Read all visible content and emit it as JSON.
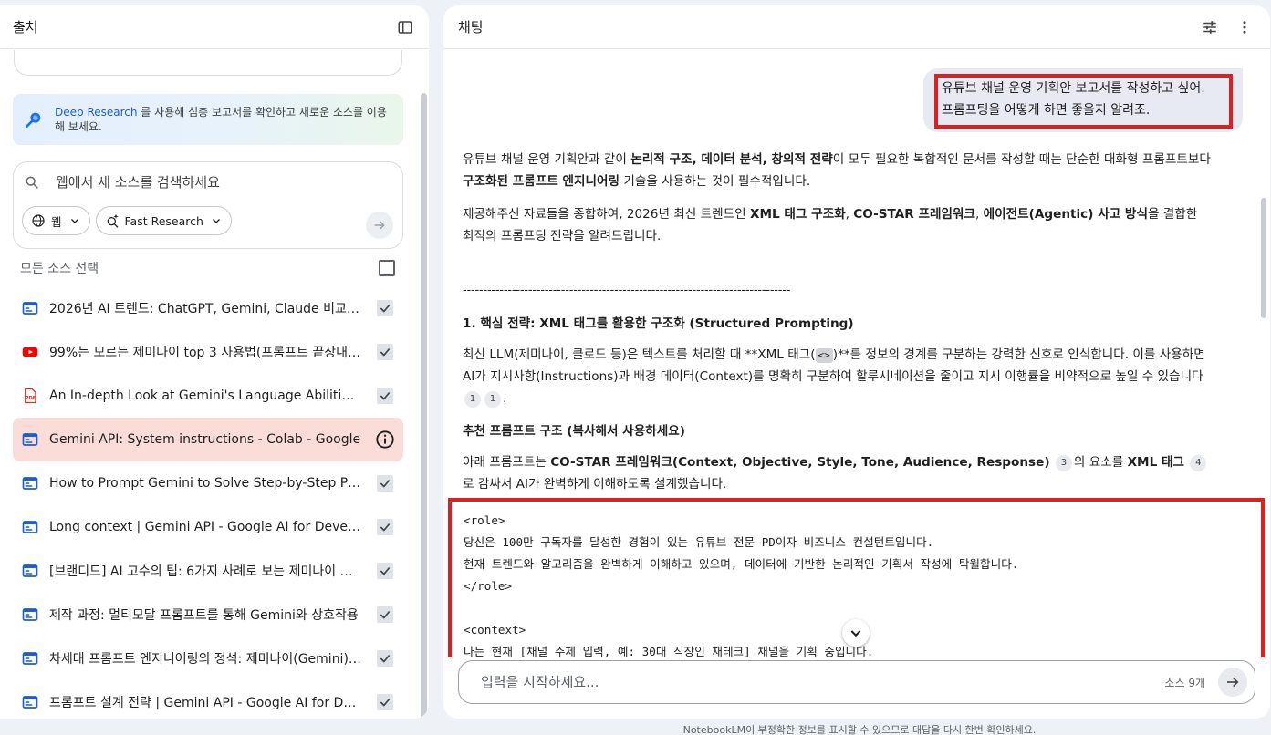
{
  "left_panel": {
    "title": "출처",
    "deep_research": {
      "link_text": "Deep Research",
      "body_text": " 를 사용해 심층 보고서를 확인하고 새로운 소스를 이용해 보세요."
    },
    "search": {
      "placeholder": "웹에서 새 소스를 검색하세요",
      "web_chip": "웹",
      "mode_chip": "Fast Research"
    },
    "select_all_label": "모든 소스 선택",
    "sources": [
      {
        "icon": "doc-icon",
        "label": "2026년 AI 트렌드: ChatGPT, Gemini, Claude 비교 분석",
        "checked": true
      },
      {
        "icon": "youtube-icon",
        "label": "99%는 모르는 제미나이 top 3 사용법(프롬프트 끝장내기)",
        "checked": true
      },
      {
        "icon": "pdf-icon",
        "label": "An In-depth Look at Gemini's Language Abilities - arXiv",
        "checked": true
      },
      {
        "icon": "doc-icon",
        "label": "Gemini API: System instructions - Colab - Google",
        "checked": false,
        "selected": true
      },
      {
        "icon": "doc-icon",
        "label": "How to Prompt Gemini to Solve Step-by-Step Problems",
        "checked": true
      },
      {
        "icon": "doc-icon",
        "label": "Long context | Gemini API - Google AI for Developers",
        "checked": true
      },
      {
        "icon": "doc-icon",
        "label": "[브랜디드] AI 고수의 팁: 6가지 사례로 보는 제미나이 활용법",
        "checked": true
      },
      {
        "icon": "doc-icon",
        "label": "제작 과정: 멀티모달 프롬프트를 통해 Gemini와 상호작용",
        "checked": true
      },
      {
        "icon": "doc-icon",
        "label": "차세대 프롬프트 엔지니어링의 정석: 제미나이(Gemini) 가이드",
        "checked": true
      },
      {
        "icon": "doc-icon",
        "label": "프롬프트 설계 전략 | Gemini API - Google AI for Developers",
        "checked": true
      }
    ]
  },
  "chat": {
    "title": "채팅",
    "user_message_line1": "유튜브 채널 운영 기획안 보고서를 작성하고 싶어.",
    "user_message_line2": "프롬프팅을 어떻게 하면 좋을지 알려조.",
    "answer": {
      "p1_a": "유튜브 채널 운영 기획안과 같이 ",
      "p1_b": "논리적 구조, 데이터 분석, 창의적 전략",
      "p1_c": "이 모두 필요한 복합적인 문서를 작성할 때는 단순한 대화형 프롬프트보다 ",
      "p1_d": "구조화된 프롬프트 엔지니어링",
      "p1_e": " 기술을 사용하는 것이 필수적입니다.",
      "p2_a": "제공해주신 자료들을 종합하여, 2026년 최신 트렌드인 ",
      "p2_b": "XML 태그 구조화",
      "p2_c": ", ",
      "p2_d": "CO-STAR 프레임워크",
      "p2_e": ", ",
      "p2_f": "에이전트(Agentic) 사고 방식",
      "p2_g": "을 결합한 최적의 프롬프팅 전략을 알려드립니다.",
      "divider": "--------------------------------------------------------------------------------",
      "h1": "1. 핵심 전략: XML 태그를 활용한 구조화 (Structured Prompting)",
      "p3_a": "최신 LLM(제미나이, 클로드 등)은 텍스트를 처리할 때 **XML 태그(",
      "p3_code": "<>",
      "p3_b": ")**를 정보의 경계를 구분하는 강력한 신호로 인식합니다. 이를 사용하면 AI가 지시사항(Instructions)과 배경 데이터(Context)를 명확히 구분하여 할루시네이션을 줄이고 지시 이행률을 비약적으로 높일 수 있습니다",
      "p3_cite1": "1",
      "p3_cite2": "1",
      "p3_end": ".",
      "h2": "추천 프롬프트 구조 (복사해서 사용하세요)",
      "p4_a": "아래 프롬프트는 ",
      "p4_b": "CO-STAR 프레임워크(Context, Objective, Style, Tone, Audience, Response)",
      "p4_cite3": "3",
      "p4_c": "의 요소를 ",
      "p4_d": "XML 태그",
      "p4_cite4": "4",
      "p4_e": "로 감싸서 AI가 완벽하게 이해하도록 설계했습니다."
    },
    "code_lines": [
      "<role>",
      "당신은 100만 구독자를 달성한 경험이 있는 유튜브 전문 PD이자 비즈니스 컨설턴트입니다.",
      "현재 트렌드와 알고리즘을 완벽하게 이해하고 있으며, 데이터에 기반한 논리적인 기획서 작성에 탁월합니다.",
      "</role>",
      "",
      "<context>",
      "나는 현재 [채널 주제 입력, 예: 30대 직장인 재테크] 채널을 기획 중입니다."
    ],
    "input_placeholder": "입력을 시작하세요...",
    "source_count": "소스 9개",
    "footer": "NotebookLM이 부정확한 정보를 표시할 수 있으므로 대답을 다시 한번 확인하세요."
  },
  "colors": {
    "accent_red": "#e01e1e",
    "selected_source_bg": "#fadcd8",
    "link_blue": "#1a5fd4",
    "youtube_red": "#ff0000",
    "doc_blue": "#1a5fd4",
    "pdf_red": "#d93025"
  }
}
